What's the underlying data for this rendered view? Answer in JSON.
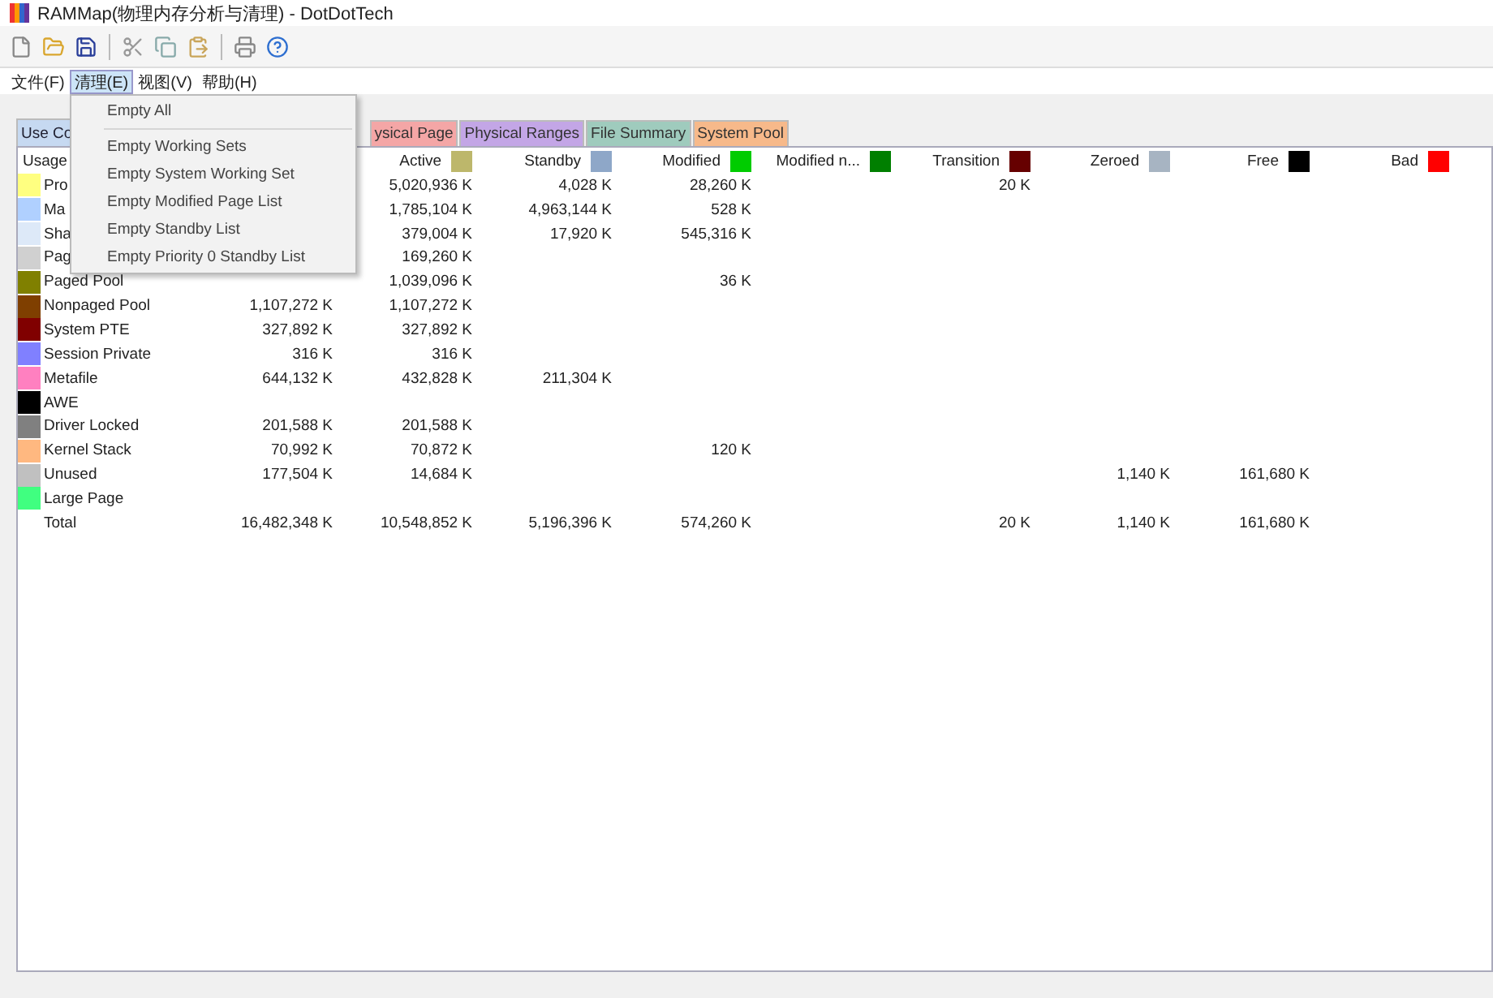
{
  "window": {
    "title": "RAMMap(物理内存分析与清理) - DotDotTech"
  },
  "menu_bar": [
    {
      "label": "文件(F)",
      "selected": false
    },
    {
      "label": "清理(E)",
      "selected": true
    },
    {
      "label": "视图(V)",
      "selected": false
    },
    {
      "label": "帮助(H)",
      "selected": false
    }
  ],
  "open_menu": {
    "items": [
      {
        "label": "Empty All",
        "kind": "item"
      },
      {
        "kind": "separator"
      },
      {
        "label": "Empty Working Sets",
        "kind": "item"
      },
      {
        "label": "Empty System Working Set",
        "kind": "item"
      },
      {
        "label": "Empty Modified Page List",
        "kind": "item"
      },
      {
        "label": "Empty Standby List",
        "kind": "item"
      },
      {
        "label": "Empty Priority 0 Standby List",
        "kind": "item"
      }
    ]
  },
  "tabs": [
    {
      "label": "Use Co",
      "selected": true,
      "color": "#c6d9f1"
    },
    {
      "label": "ysical Page",
      "selected": false,
      "color": "#f4a6a6"
    },
    {
      "label": "Physical Ranges",
      "selected": false,
      "color": "#c3a6e6"
    },
    {
      "label": "File Summary",
      "selected": false,
      "color": "#9fcbbd"
    },
    {
      "label": "System Pool",
      "selected": false,
      "color": "#f7b98a"
    }
  ],
  "table": {
    "columns": [
      {
        "label": "Usage"
      },
      {},
      {
        "label": "Active",
        "color": "#bdb76b"
      },
      {
        "label": "Standby",
        "color": "#8ea7c8"
      },
      {
        "label": "Modified",
        "color": "#00cc00"
      },
      {
        "label": "Modified n...",
        "color": "#007f00"
      },
      {
        "label": "Transition",
        "color": "#660000"
      },
      {
        "label": "Zeroed",
        "color": "#a7b4c2"
      },
      {
        "label": "Free",
        "color": "#000000"
      },
      {
        "label": "Bad",
        "color": "#ff0000"
      }
    ],
    "rows": [
      {
        "color": "#ffff80",
        "cells": [
          "Pro",
          "",
          "5,020,936 K",
          "4,028 K",
          "28,260 K",
          "",
          "20 K",
          "",
          "",
          ""
        ]
      },
      {
        "color": "#b0d0ff",
        "cells": [
          "Ma",
          "",
          "1,785,104 K",
          "4,963,144 K",
          "528 K",
          "",
          "",
          "",
          "",
          ""
        ]
      },
      {
        "color": "#dde9f8",
        "cells": [
          "Sha",
          "",
          "379,004 K",
          "17,920 K",
          "545,316 K",
          "",
          "",
          "",
          "",
          ""
        ]
      },
      {
        "color": "#d0d0d0",
        "cells": [
          "Pag",
          "",
          "169,260 K",
          "",
          "",
          "",
          "",
          "",
          "",
          ""
        ]
      },
      {
        "color": "#808000",
        "cells": [
          "Paged Pool",
          "",
          "1,039,096 K",
          "",
          "36 K",
          "",
          "",
          "",
          "",
          ""
        ]
      },
      {
        "color": "#7f3f00",
        "cells": [
          "Nonpaged Pool",
          "1,107,272 K",
          "1,107,272 K",
          "",
          "",
          "",
          "",
          "",
          "",
          ""
        ]
      },
      {
        "color": "#800000",
        "cells": [
          "System PTE",
          "327,892 K",
          "327,892 K",
          "",
          "",
          "",
          "",
          "",
          "",
          ""
        ]
      },
      {
        "color": "#8080ff",
        "cells": [
          "Session Private",
          "316 K",
          "316 K",
          "",
          "",
          "",
          "",
          "",
          "",
          ""
        ]
      },
      {
        "color": "#ff80c0",
        "cells": [
          "Metafile",
          "644,132 K",
          "432,828 K",
          "211,304 K",
          "",
          "",
          "",
          "",
          "",
          ""
        ]
      },
      {
        "color": "#000000",
        "cells": [
          "AWE",
          "",
          "",
          "",
          "",
          "",
          "",
          "",
          "",
          ""
        ]
      },
      {
        "color": "#808080",
        "cells": [
          "Driver Locked",
          "201,588 K",
          "201,588 K",
          "",
          "",
          "",
          "",
          "",
          "",
          ""
        ]
      },
      {
        "color": "#ffb880",
        "cells": [
          "Kernel Stack",
          "70,992 K",
          "70,872 K",
          "",
          "120 K",
          "",
          "",
          "",
          "",
          ""
        ]
      },
      {
        "color": "#c0c0c0",
        "cells": [
          "Unused",
          "177,504 K",
          "14,684 K",
          "",
          "",
          "",
          "",
          "1,140 K",
          "161,680 K",
          ""
        ]
      },
      {
        "color": "#40ff80",
        "cells": [
          "Large Page",
          "",
          "",
          "",
          "",
          "",
          "",
          "",
          "",
          ""
        ]
      },
      {
        "cells": [
          "Total",
          "16,482,348 K",
          "10,548,852 K",
          "5,196,396 K",
          "574,260 K",
          "",
          "20 K",
          "1,140 K",
          "161,680 K",
          ""
        ]
      }
    ]
  }
}
